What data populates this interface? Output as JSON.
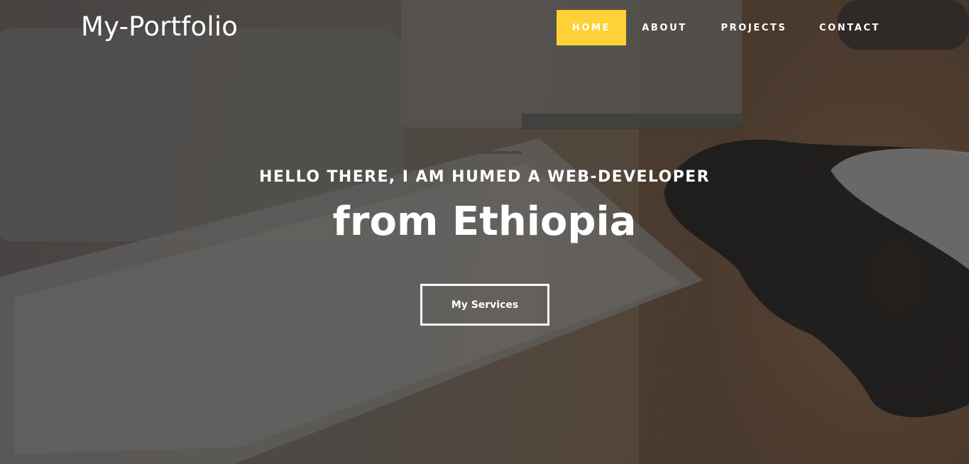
{
  "header": {
    "brand": "My-Portfolio",
    "nav": [
      {
        "label": "HOME",
        "active": true
      },
      {
        "label": "ABOUT",
        "active": false
      },
      {
        "label": "PROJECTS",
        "active": false
      },
      {
        "label": "CONTACT",
        "active": false
      }
    ]
  },
  "hero": {
    "subheading": "HELLO THERE, I AM HUMED A WEB-DEVELOPER",
    "heading": "from Ethiopia",
    "button_label": "My Services",
    "background_image": "desk-with-keyboard-and-mouse-photo"
  },
  "colors": {
    "accent": "#fed136",
    "text": "#ffffff"
  }
}
